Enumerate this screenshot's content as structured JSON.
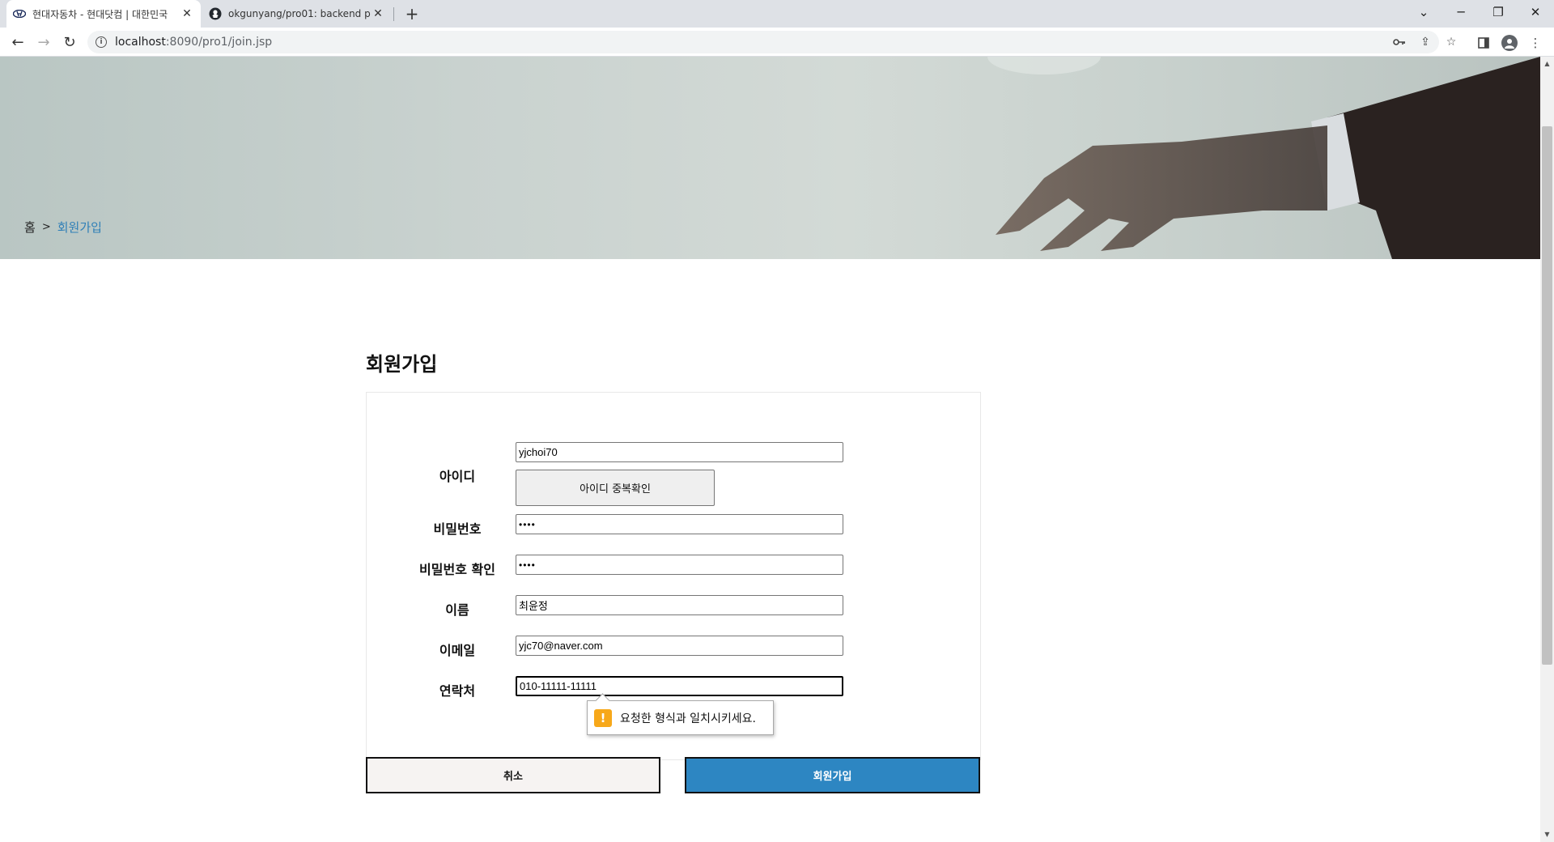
{
  "browser": {
    "tabs": [
      {
        "title": "현대자동차 - 현대닷컴 | 대한민국",
        "favicon": "hyundai-logo-icon",
        "active": true
      },
      {
        "title": "okgunyang/pro01: backend proj",
        "favicon": "github-icon",
        "active": false
      }
    ],
    "url_host": "localhost",
    "url_rest": ":8090/pro1/join.jsp"
  },
  "breadcrumb": {
    "home": "홈",
    "separator": ">",
    "current": "회원가입"
  },
  "page_title": "회원가입",
  "form": {
    "id_label": "아이디",
    "id_value": "yjchoi70",
    "id_check_button": "아이디 중복확인",
    "password_label": "비밀번호",
    "password_value": "••••",
    "password_confirm_label": "비밀번호 확인",
    "password_confirm_value": "••••",
    "name_label": "이름",
    "name_value": "최윤정",
    "email_label": "이메일",
    "email_value": "yjc70@naver.com",
    "phone_label": "연락처",
    "phone_value": "010-11111-11111"
  },
  "validation_tooltip": "요청한 형식과 일치시키세요.",
  "buttons": {
    "cancel": "취소",
    "submit": "회원가입"
  },
  "colors": {
    "accent_blue": "#2d86c2",
    "breadcrumb_link": "#2f7fb7",
    "warning": "#f7a81a"
  }
}
